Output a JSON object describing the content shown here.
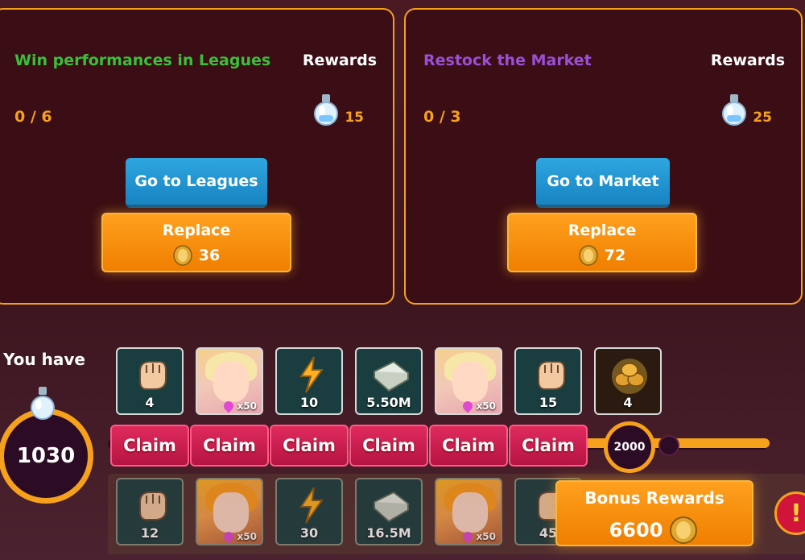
{
  "tasks": [
    {
      "title": "Win performances in Leagues",
      "title_color": "#3bbf3b",
      "rewards_label": "Rewards",
      "progress": "0 / 6",
      "reward_amount": "15",
      "reward_icon": "potion-icon",
      "go_label": "Go to Leagues",
      "replace_label": "Replace",
      "replace_cost": "36"
    },
    {
      "title": "Restock the Market",
      "title_color": "#9b4fd6",
      "rewards_label": "Rewards",
      "progress": "0 / 3",
      "reward_amount": "25",
      "reward_icon": "potion-icon",
      "go_label": "Go to Market",
      "replace_label": "Replace",
      "replace_cost": "72"
    }
  ],
  "balance": {
    "label": "You have",
    "amount": "1030"
  },
  "reward_track": {
    "top_tiles": [
      {
        "icon": "fist-icon",
        "label": "4"
      },
      {
        "icon": "girl-portrait",
        "label": "x50"
      },
      {
        "icon": "lightning-icon",
        "label": "10"
      },
      {
        "icon": "cash-stack-icon",
        "label": "5.50M"
      },
      {
        "icon": "girl-portrait",
        "label": "x50"
      },
      {
        "icon": "fist-icon",
        "label": "15"
      },
      {
        "icon": "gold-coins-pile-icon",
        "label": "4"
      }
    ],
    "claim_label": "Claim",
    "claim_count": 6,
    "milestone": "2000",
    "bottom_tiles": [
      {
        "icon": "fist-icon",
        "label": "12"
      },
      {
        "icon": "girl-portrait",
        "label": "x50"
      },
      {
        "icon": "lightning-icon",
        "label": "30"
      },
      {
        "icon": "cash-stack-icon",
        "label": "16.5M"
      },
      {
        "icon": "girl-portrait",
        "label": "x50"
      },
      {
        "icon": "fist-icon",
        "label": "45"
      }
    ]
  },
  "bonus": {
    "title": "Bonus Rewards",
    "amount": "6600",
    "icon": "coin-icon",
    "badge": "!"
  },
  "colors": {
    "accent": "#f6a11c",
    "claim": "#c8184c",
    "go_button": "#1e90cf",
    "panel_bg": "#3a0e14"
  }
}
